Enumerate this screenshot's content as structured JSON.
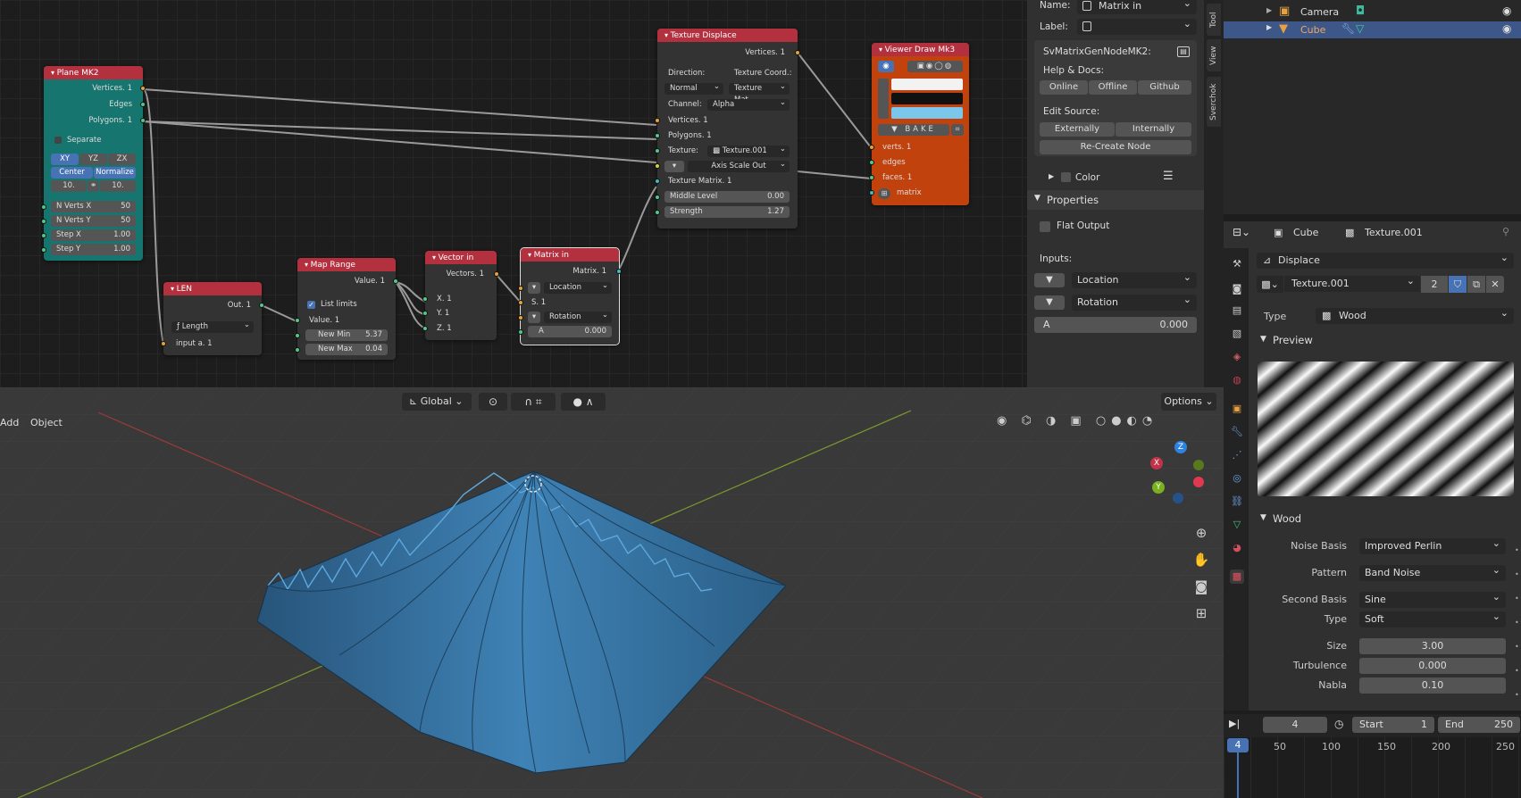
{
  "nodes": {
    "plane": {
      "title": "Plane MK2",
      "vertices": "Vertices. 1",
      "edges": "Edges",
      "polygons": "Polygons. 1",
      "separate": "Separate",
      "xy": "XY",
      "yz": "YZ",
      "zx": "ZX",
      "center": "Center",
      "normalize": "Normalize",
      "size_x": "10.",
      "size_y": "10.",
      "nverts_x_label": "N Verts X",
      "nverts_x": "50",
      "nverts_y_label": "N Verts Y",
      "nverts_y": "50",
      "stepx_label": "Step X",
      "stepx": "1.00",
      "stepy_label": "Step Y",
      "stepy": "1.00"
    },
    "len": {
      "title": "LEN",
      "out": "Out. 1",
      "mode": "Length",
      "input": "input a. 1"
    },
    "maprange": {
      "title": "Map Range",
      "value_out": "Value. 1",
      "list_limits": "List limits",
      "value_in": "Value. 1",
      "newmin_label": "New Min",
      "newmin": "5.37",
      "newmax_label": "New Max",
      "newmax": "0.04"
    },
    "vectorin": {
      "title": "Vector in",
      "vectors": "Vectors. 1",
      "x": "X. 1",
      "y": "Y. 1",
      "z": "Z. 1"
    },
    "matrixin": {
      "title": "Matrix in",
      "matrix": "Matrix. 1",
      "location": "Location",
      "s": "S. 1",
      "rotation": "Rotation",
      "a_label": "A",
      "a": "0.000"
    },
    "texdisp": {
      "title": "Texture Displace",
      "vertices_out": "Vertices. 1",
      "direction": "Direction:",
      "texcoord": "Texture Coord.:",
      "dir_val": "Normal",
      "coord_val": "Texture Mat...",
      "channel_label": "Channel:",
      "channel": "Alpha",
      "vertices_in": "Vertices. 1",
      "polygons_in": "Polygons. 1",
      "texture_label": "Texture:",
      "texture": "Texture.001",
      "axis": "Axis Scale Out",
      "texmatrix": "Texture Matrix. 1",
      "midlevel_label": "Middle Level",
      "midlevel": "0.00",
      "strength_label": "Strength",
      "strength": "1.27"
    },
    "viewer": {
      "title": "Viewer Draw Mk3",
      "bake": "BAKE",
      "verts": "verts. 1",
      "edges": "edges",
      "faces": "faces. 1",
      "matrix": "matrix"
    }
  },
  "npanel": {
    "name_label": "Name:",
    "name": "Matrix in",
    "label_label": "Label:",
    "label": "",
    "node_id": "SvMatrixGenNodeMK2:",
    "help": "Help & Docs:",
    "online": "Online",
    "offline": "Offline",
    "github": "Github",
    "edit_source": "Edit Source:",
    "externally": "Externally",
    "internally": "Internally",
    "recreate": "Re-Create Node",
    "color": "Color",
    "properties": "Properties",
    "flat_output": "Flat Output",
    "inputs": "Inputs:",
    "location": "Location",
    "rotation": "Rotation",
    "a_label": "A",
    "a": "0.000"
  },
  "tabs": {
    "tool": "Tool",
    "view": "View",
    "sverchok": "Sverchok"
  },
  "viewport": {
    "orientation": "Global",
    "add": "Add",
    "object": "Object",
    "options": "Options",
    "axis_x": "X",
    "axis_y": "Y",
    "axis_z": "Z"
  },
  "outliner": {
    "camera": "Camera",
    "cube": "Cube"
  },
  "properties": {
    "object": "Cube",
    "texture": "Texture.001",
    "displace": "Displace",
    "tex_name": "Texture.001",
    "users": "2",
    "type_label": "Type",
    "type": "Wood",
    "preview": "Preview",
    "wood": "Wood",
    "noise_basis_label": "Noise Basis",
    "noise_basis": "Improved Perlin",
    "pattern_label": "Pattern",
    "pattern": "Band Noise",
    "second_basis_label": "Second Basis",
    "second_basis": "Sine",
    "type2_label": "Type",
    "type2": "Soft",
    "size_label": "Size",
    "size": "3.00",
    "turbulence_label": "Turbulence",
    "turbulence": "0.000",
    "nabla_label": "Nabla",
    "nabla": "0.10"
  },
  "timeline": {
    "current": "4",
    "start_label": "Start",
    "start": "1",
    "end_label": "End",
    "end": "250",
    "frame": "4",
    "ticks": [
      "50",
      "100",
      "150",
      "200",
      "250"
    ]
  }
}
